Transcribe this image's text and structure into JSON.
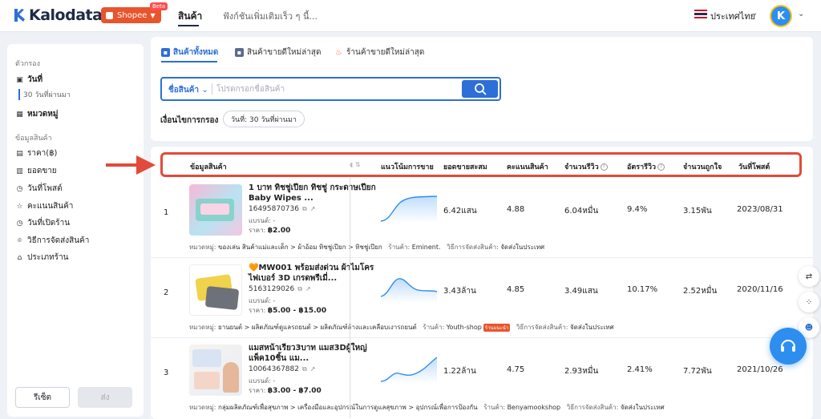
{
  "header": {
    "app_name": "Kalodata",
    "platform": "Shopee",
    "platform_badge": "Beta",
    "nav_products": "สินค้า",
    "nav_more": "ฟังก์ชันเพิ่มเติมเร็ว ๆ นี้...",
    "country": "ประเทศไทย",
    "avatar_initial": "K"
  },
  "sidebar": {
    "filters_title": "ตัวกรอง",
    "date_label": "วันที่",
    "date_value": "30 วันที่ผ่านมา",
    "category_label": "หมวดหมู่",
    "product_info_title": "ข้อมูลสินค้า",
    "items": [
      {
        "label": "ราคา(฿)",
        "icon": "price-icon"
      },
      {
        "label": "ยอดขาย",
        "icon": "sales-icon"
      },
      {
        "label": "วันที่โพสต์",
        "icon": "clock-icon"
      },
      {
        "label": "คะแนนสินค้า",
        "icon": "star-icon"
      },
      {
        "label": "วันที่เปิดร้าน",
        "icon": "clock-icon"
      },
      {
        "label": "วิธีการจัดส่งสินค้า",
        "icon": "location-icon"
      },
      {
        "label": "ประเภทร้าน",
        "icon": "shop-icon"
      }
    ],
    "reset_label": "รีเซ็ต",
    "submit_label": "ส่ง"
  },
  "tabs": [
    {
      "label": "สินค้าทั้งหมด",
      "icon": "grid-icon",
      "active": true
    },
    {
      "label": "สินค้าขายดีใหม่ล่าสุด",
      "icon": "new-icon",
      "active": false
    },
    {
      "label": "ร้านค้าขายดีใหม่ล่าสุด",
      "icon": "fire-icon",
      "active": false
    }
  ],
  "search": {
    "field_selector": "ชื่อสินค้า",
    "placeholder": "โปรดกรอกชื่อสินค้า"
  },
  "filter_conditions": {
    "label": "เงื่อนไขการกรอง",
    "chip": "วันที่: 30 วันที่ผ่านมา"
  },
  "table": {
    "columns": {
      "product_info": "ข้อมูลสินค้า",
      "trend": "แนวโน้มการขาย",
      "total_sales": "ยอดขายสะสม",
      "rating": "คะแนนสินค้า",
      "reviews": "จำนวนรีวิว",
      "review_rate": "อัตรารีวิว",
      "likes": "จำนวนถูกใจ",
      "post_date": "วันที่โพสต์"
    },
    "labels": {
      "brand": "แบรนด์: -",
      "price_prefix": "ราคา: ",
      "category_prefix": "หมวดหมู่: ",
      "shop_prefix": "ร้านค้า: ",
      "shipping_prefix": "วิธีการจัดส่งสินค้า: ",
      "recommended_badge": "ร้านแนะนำ"
    },
    "rows": [
      {
        "rank": "1",
        "name": "1 บาท ทิชชู่เปียก ทิชชู่ กระดาษเปียก Baby Wipes ...",
        "id": "16495870736",
        "price": "฿2.00",
        "category": "ของเล่น สินค้าแม่และเด็ก > ผ้าอ้อม ทิชชู่เปียก > ทิชชู่เปียก",
        "shop": "Eminent.",
        "shipping": "จัดส่งในประเทศ",
        "total_sales": "6.42แสน",
        "rating": "4.88",
        "reviews": "6.04หมื่น",
        "review_rate": "9.4%",
        "likes": "3.15พัน",
        "post_date": "2023/08/31"
      },
      {
        "rank": "2",
        "name": "🧡MW001 พร้อมส่งด่วน ผ้าไมโครไฟเบอร์ 3D เกรดพรีเมี่...",
        "id": "5163129026",
        "price": "฿5.00 - ฿15.00",
        "category": "ยานยนต์ > ผลิตภัณฑ์ดูแลรถยนต์ > ผลิตภัณฑ์ล้างและเคลือบเงารถยนต์",
        "shop": "Youth-shop",
        "shop_badge": true,
        "shipping": "จัดส่งในประเทศ",
        "total_sales": "3.43ล้าน",
        "rating": "4.85",
        "reviews": "3.49แสน",
        "review_rate": "10.17%",
        "likes": "2.52หมื่น",
        "post_date": "2020/11/16"
      },
      {
        "rank": "3",
        "name": "แมสหน้าเรียว3บาท แมส3Dผู้ใหญ่ แพ็ค10ชิ้น แม...",
        "id": "10064367882",
        "price": "฿3.00 - ฿7.00",
        "category": "กลุ่มผลิตภัณฑ์เพื่อสุขภาพ > เครื่องมือและอุปกรณ์ในการดูแลสุขภาพ > อุปกรณ์เพื่อการป้องกัน",
        "shop": "Benyamookshop",
        "shipping": "จัดส่งในประเทศ",
        "total_sales": "1.22ล้าน",
        "rating": "4.75",
        "reviews": "2.93หมื่น",
        "review_rate": "2.41%",
        "likes": "7.72พัน",
        "post_date": "2021/10/26"
      }
    ]
  },
  "colors": {
    "accent": "#2d6fd6",
    "shopee": "#e8542c",
    "highlight": "#e24a3b"
  }
}
